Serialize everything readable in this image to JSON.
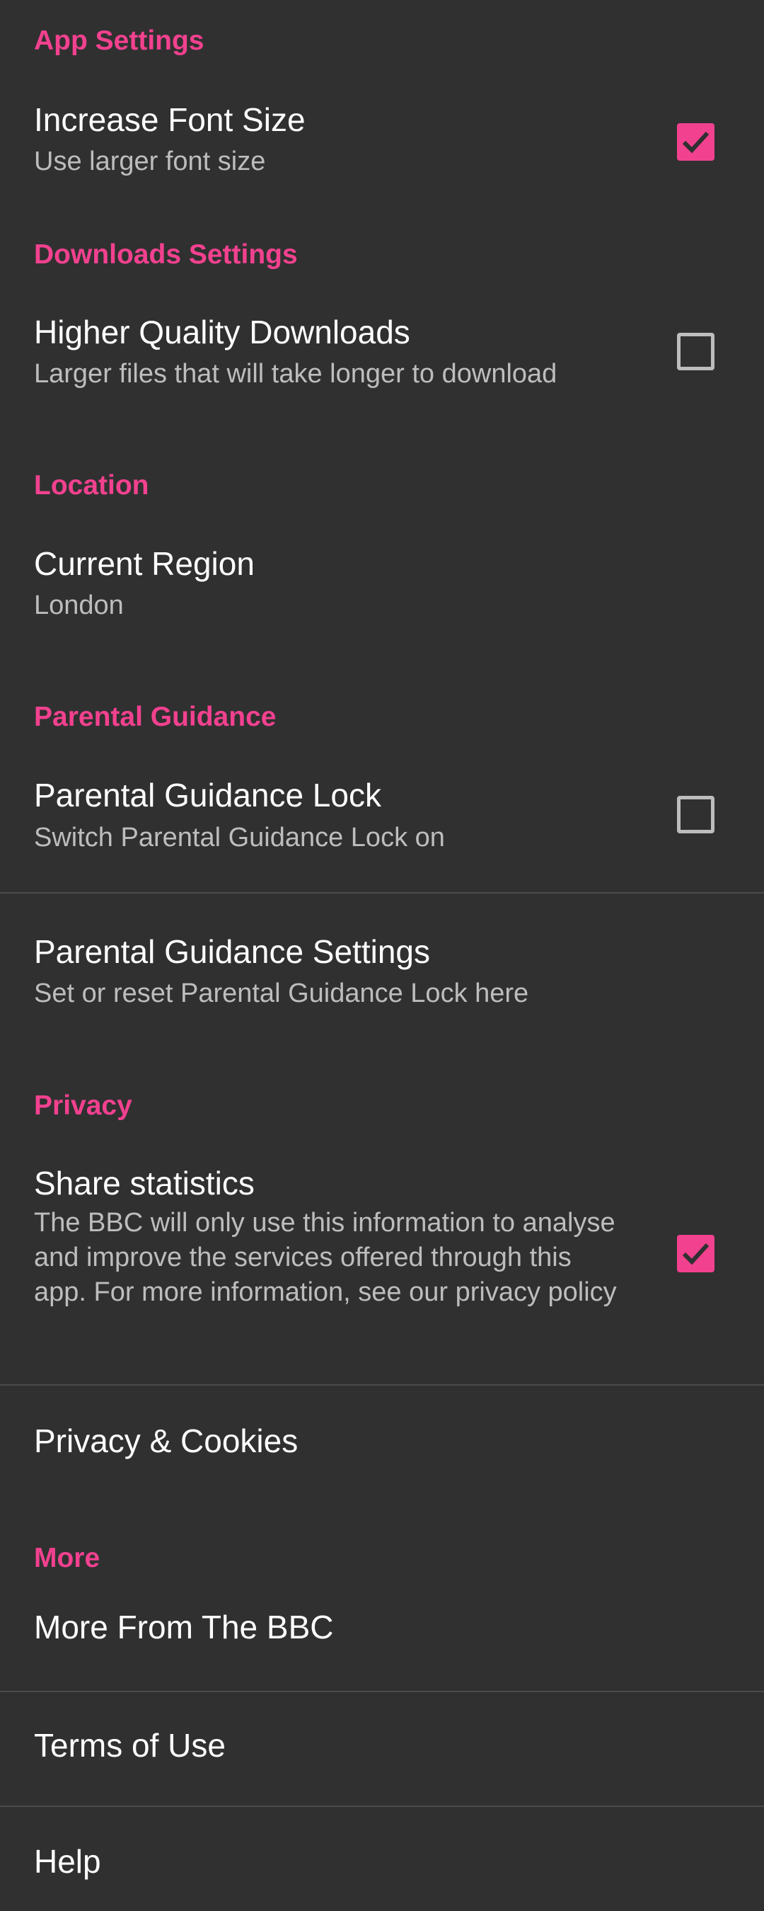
{
  "colors": {
    "accent": "#f2418f",
    "background": "#303030",
    "text": "#ffffff",
    "secondary_text": "#bdbdbd",
    "divider": "#4a4a4a"
  },
  "sections": {
    "app_settings": {
      "header": "App Settings",
      "font_size": {
        "title": "Increase Font Size",
        "subtitle": "Use larger font size",
        "checked": true
      }
    },
    "downloads": {
      "header": "Downloads Settings",
      "quality": {
        "title": "Higher Quality Downloads",
        "subtitle": "Larger files that will take longer to download",
        "checked": false
      }
    },
    "location": {
      "header": "Location",
      "region": {
        "title": "Current Region",
        "subtitle": "London"
      }
    },
    "parental": {
      "header": "Parental Guidance",
      "lock": {
        "title": "Parental Guidance Lock",
        "subtitle": "Switch Parental Guidance Lock on",
        "checked": false
      },
      "settings": {
        "title": "Parental Guidance Settings",
        "subtitle": "Set or reset Parental Guidance Lock here"
      }
    },
    "privacy": {
      "header": "Privacy",
      "stats": {
        "title": "Share statistics",
        "subtitle": "The BBC will only use this information to analyse and improve the services offered through this app. For more information, see our privacy policy",
        "checked": true
      },
      "cookies": {
        "title": "Privacy & Cookies"
      }
    },
    "more": {
      "header": "More",
      "more_bbc": {
        "title": "More From The BBC"
      },
      "terms": {
        "title": "Terms of Use"
      },
      "help": {
        "title": "Help"
      }
    }
  }
}
